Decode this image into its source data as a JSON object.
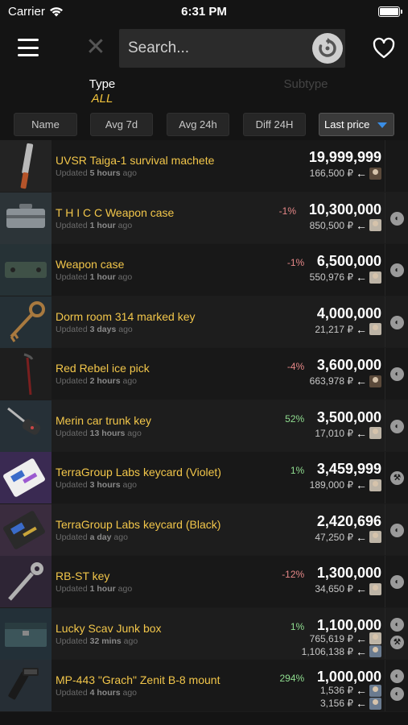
{
  "status": {
    "carrier": "Carrier",
    "time": "6:31 PM"
  },
  "search": {
    "placeholder": "Search..."
  },
  "filters": {
    "type_label": "Type",
    "type_value": "ALL",
    "subtype_label": "Subtype"
  },
  "sort": {
    "name": "Name",
    "avg7d": "Avg 7d",
    "avg24h": "Avg 24h",
    "diff24h": "Diff 24H",
    "last_price": "Last price"
  },
  "items": [
    {
      "name": "UVSR Taiga-1 survival machete",
      "updated_prefix": "Updated",
      "updated_when": "5 hours",
      "updated_suffix": "ago",
      "diff": "",
      "price": "19,999,999",
      "sub": [
        "166,500 ₽"
      ],
      "thumb": "machete"
    },
    {
      "name": "T H I C C Weapon case",
      "updated_prefix": "Updated",
      "updated_when": "1 hour",
      "updated_suffix": "ago",
      "diff": "-1%",
      "price": "10,300,000",
      "sub": [
        "850,500 ₽"
      ],
      "thumb": "case-grey"
    },
    {
      "name": "Weapon case",
      "updated_prefix": "Updated",
      "updated_when": "1 hour",
      "updated_suffix": "ago",
      "diff": "-1%",
      "price": "6,500,000",
      "sub": [
        "550,976 ₽"
      ],
      "thumb": "case-green"
    },
    {
      "name": "Dorm room 314 marked key",
      "updated_prefix": "Updated",
      "updated_when": "3 days",
      "updated_suffix": "ago",
      "diff": "",
      "price": "4,000,000",
      "sub": [
        "21,217 ₽"
      ],
      "thumb": "key-old"
    },
    {
      "name": "Red Rebel ice pick",
      "updated_prefix": "Updated",
      "updated_when": "2 hours",
      "updated_suffix": "ago",
      "diff": "-4%",
      "price": "3,600,000",
      "sub": [
        "663,978 ₽"
      ],
      "thumb": "icepick"
    },
    {
      "name": "Merin car trunk key",
      "updated_prefix": "Updated",
      "updated_when": "13 hours",
      "updated_suffix": "ago",
      "diff": "52%",
      "price": "3,500,000",
      "sub": [
        "17,010 ₽"
      ],
      "thumb": "carkey"
    },
    {
      "name": "TerraGroup Labs keycard (Violet)",
      "updated_prefix": "Updated",
      "updated_when": "3 hours",
      "updated_suffix": "ago",
      "diff": "1%",
      "price": "3,459,999",
      "sub": [
        "189,000 ₽"
      ],
      "thumb": "card-violet"
    },
    {
      "name": "TerraGroup Labs keycard (Black)",
      "updated_prefix": "Updated",
      "updated_when": "a day",
      "updated_suffix": "ago",
      "diff": "",
      "price": "2,420,696",
      "sub": [
        "47,250 ₽"
      ],
      "thumb": "card-black"
    },
    {
      "name": "RB-ST key",
      "updated_prefix": "Updated",
      "updated_when": "1 hour",
      "updated_suffix": "ago",
      "diff": "-12%",
      "price": "1,300,000",
      "sub": [
        "34,650 ₽"
      ],
      "thumb": "key-silver"
    },
    {
      "name": "Lucky Scav Junk box",
      "updated_prefix": "Updated",
      "updated_when": "32 mins",
      "updated_suffix": "ago",
      "diff": "1%",
      "price": "1,100,000",
      "sub": [
        "765,619 ₽",
        "1,106,138 ₽"
      ],
      "thumb": "junkbox"
    },
    {
      "name": "MP-443 \"Grach\" Zenit B-8 mount",
      "updated_prefix": "Updated",
      "updated_when": "4 hours",
      "updated_suffix": "ago",
      "diff": "294%",
      "price": "1,000,000",
      "sub": [
        "1,536 ₽",
        "3,156 ₽"
      ],
      "thumb": "mount"
    }
  ]
}
